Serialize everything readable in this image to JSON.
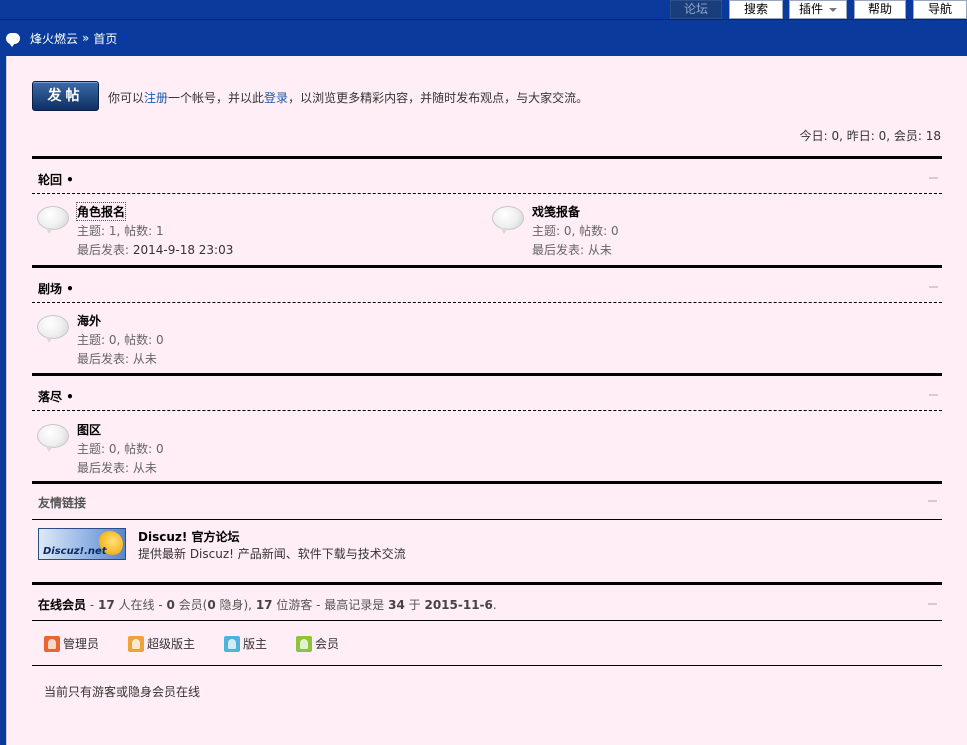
{
  "nav": {
    "forum": "论坛",
    "search": "搜索",
    "plugins": "插件",
    "help": "帮助",
    "navigation": "导航"
  },
  "breadcrumb": {
    "site": "烽火燃云",
    "separator": "»",
    "current": "首页"
  },
  "post_button": "发帖",
  "intro": {
    "prefix": "你可以",
    "register": "注册",
    "mid1": "一个帐号，并以此",
    "login": "登录",
    "suffix": "，以浏览更多精彩内容，并随时发布观点，与大家交流。"
  },
  "stats": "今日: 0, 昨日: 0, 会员: 18",
  "categories": [
    {
      "title": "轮回 •",
      "forums": [
        {
          "name": "角色报名",
          "counts": "主题: 1, 帖数: 1",
          "last_label": "最后发表: ",
          "last_value": "2014-9-18 23:03"
        },
        {
          "name": "戏笺报备",
          "counts": "主题: 0, 帖数: 0",
          "last_label": "最后发表: ",
          "last_value": "从未"
        }
      ]
    },
    {
      "title": "剧场 •",
      "forums": [
        {
          "name": "海外",
          "counts": "主题: 0, 帖数: 0",
          "last_label": "最后发表: ",
          "last_value": "从未"
        }
      ]
    },
    {
      "title": "落尽 •",
      "forums": [
        {
          "name": "图区",
          "counts": "主题: 0, 帖数: 0",
          "last_label": "最后发表: ",
          "last_value": "从未"
        }
      ]
    }
  ],
  "links": {
    "title": "友情链接",
    "items": [
      {
        "logo_text": "Discuz!.net",
        "name": "Discuz! 官方论坛",
        "desc": "提供最新 Discuz! 产品新闻、软件下载与技术交流"
      }
    ]
  },
  "online": {
    "title": "在线会员",
    "dash1": " - ",
    "total": "17",
    "total_label": " 人在线 - ",
    "members": "0",
    "members_label": " 会员(",
    "hidden": "0",
    "hidden_label": " 隐身), ",
    "guests": "17",
    "guests_label": " 位游客 - 最高记录是 ",
    "record": "34",
    "record_mid": " 于 ",
    "record_date": "2015-11-6",
    "end": "."
  },
  "legend": [
    {
      "label": "管理员",
      "color": "#e8662f"
    },
    {
      "label": "超级版主",
      "color": "#f0a23a"
    },
    {
      "label": "版主",
      "color": "#4fb4dc"
    },
    {
      "label": "会员",
      "color": "#8cc43a"
    }
  ],
  "no_member_text": "当前只有游客或隐身会员在线"
}
